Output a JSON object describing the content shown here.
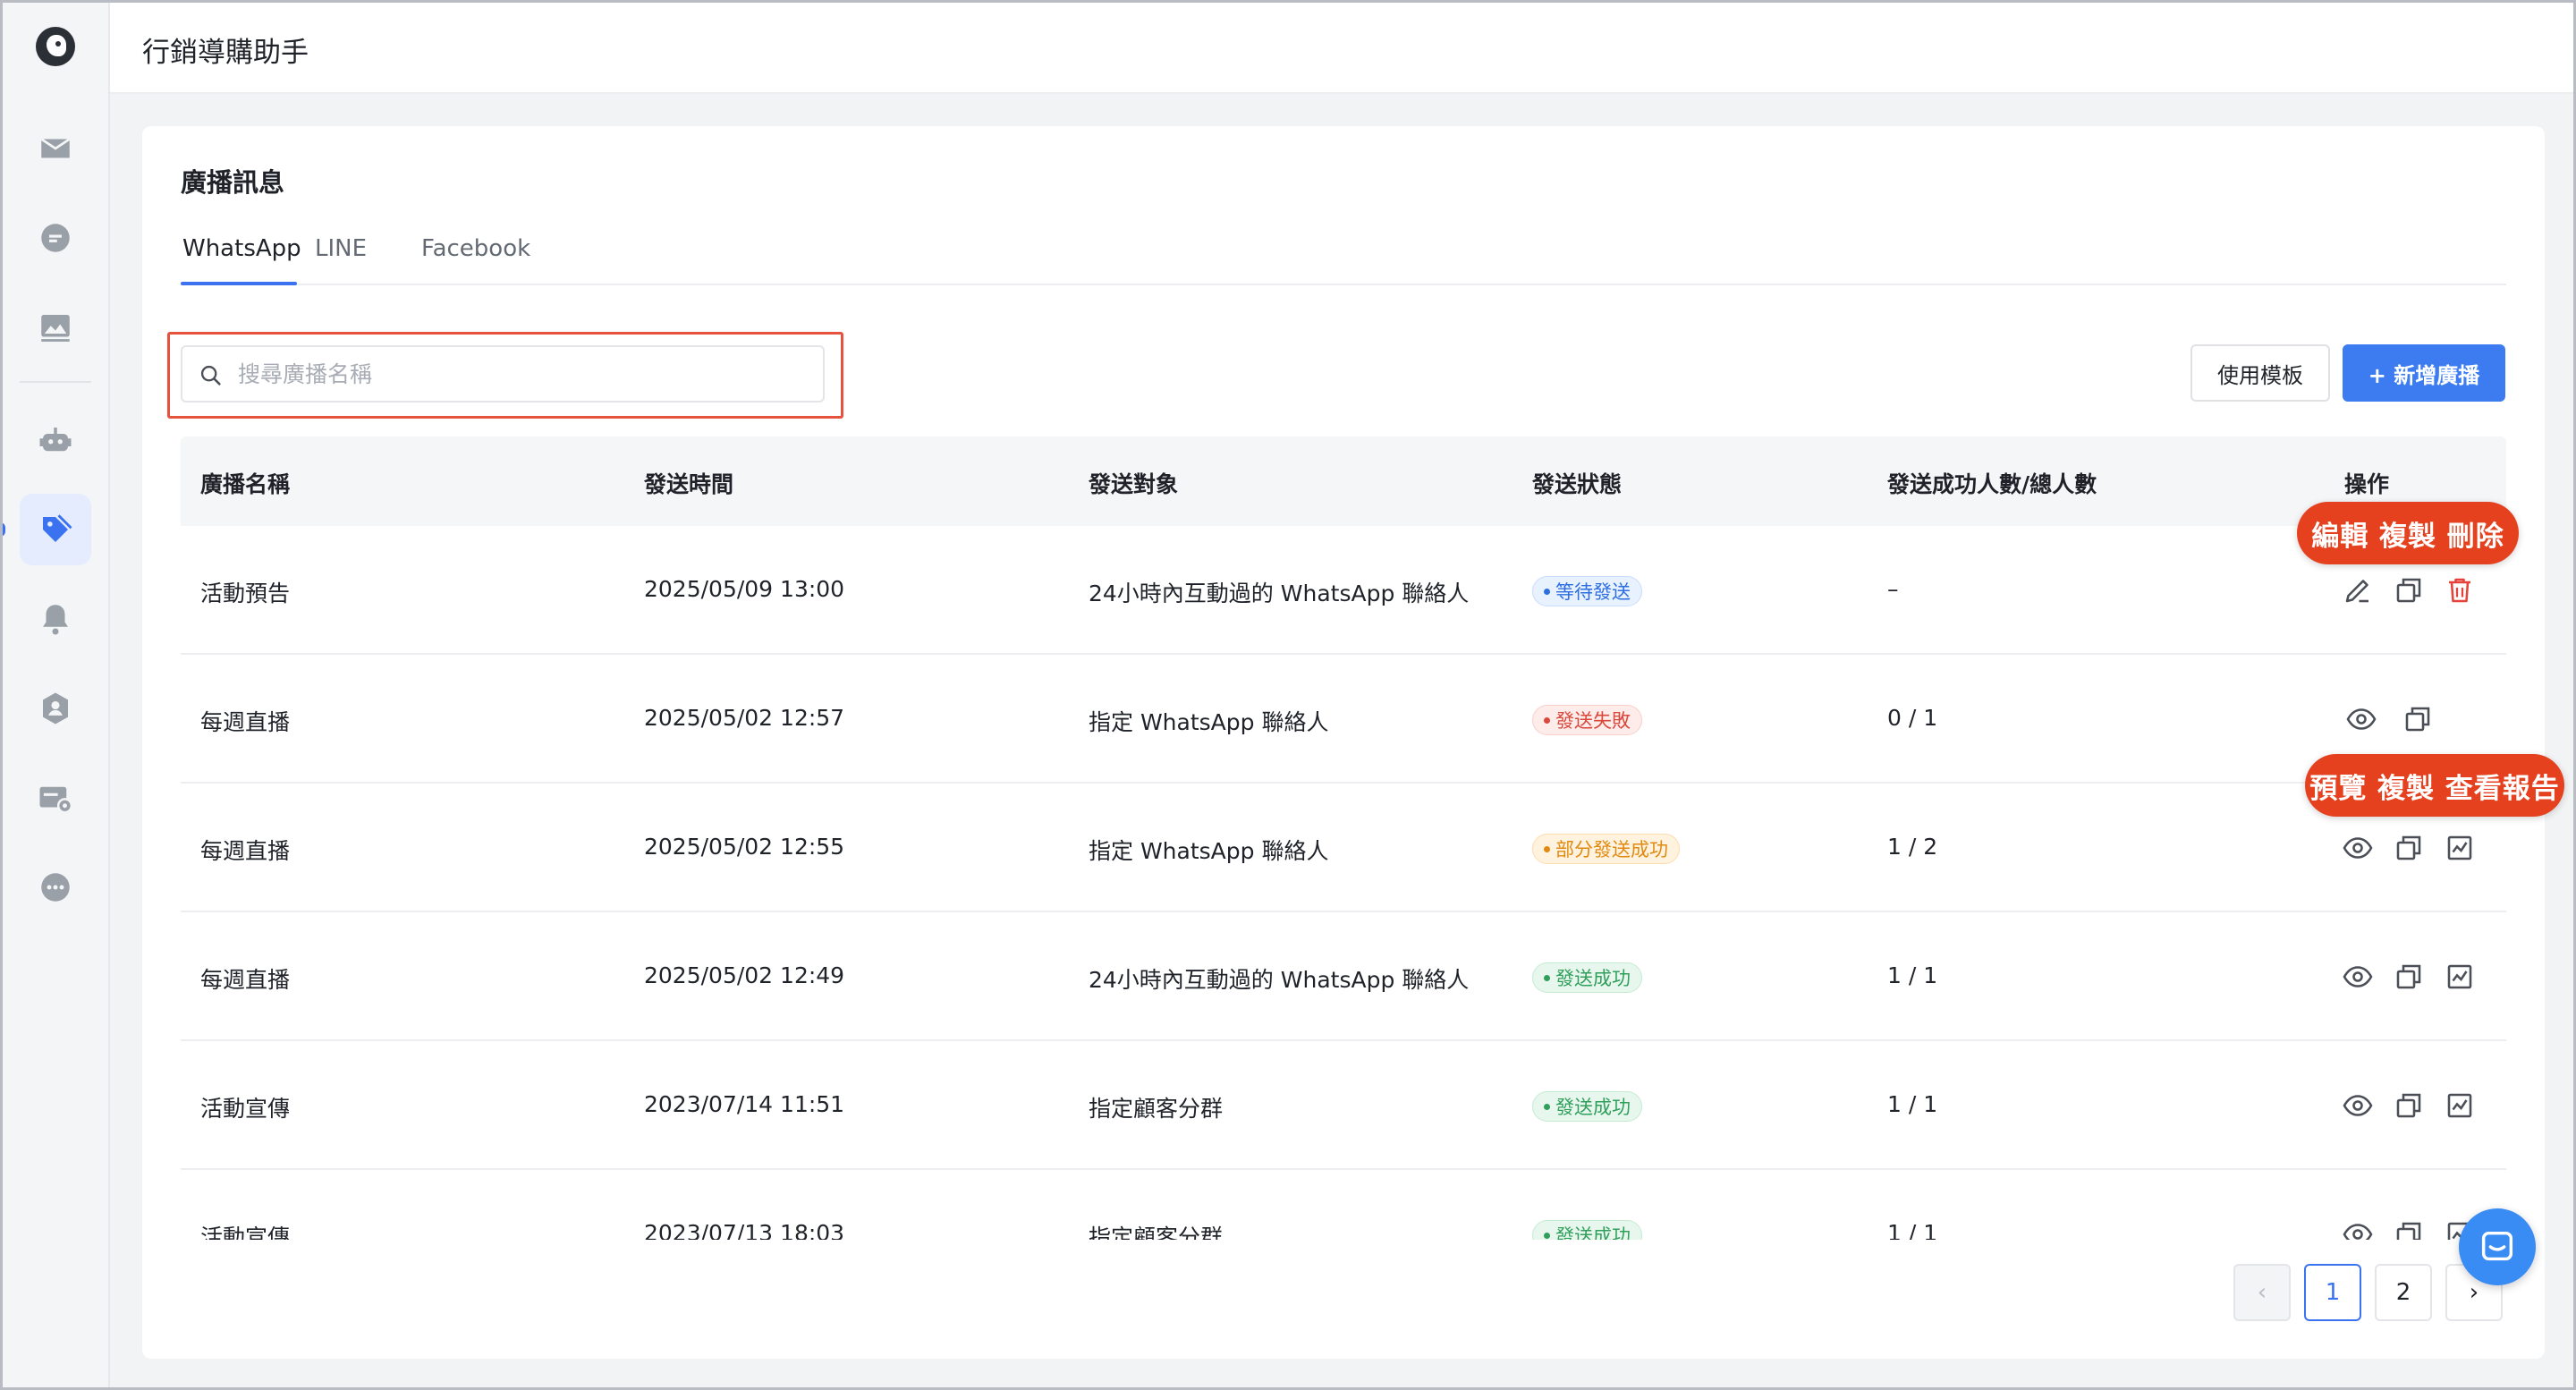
{
  "app": {
    "title": "行銷導購助手"
  },
  "sidebar": {
    "items": [
      {
        "icon": "inbox-icon"
      },
      {
        "icon": "chat-bubble-icon"
      },
      {
        "icon": "image-gallery-icon"
      },
      {
        "icon": "robot-icon"
      },
      {
        "icon": "tag-icon",
        "active": true
      },
      {
        "icon": "bell-icon"
      },
      {
        "icon": "user-badge-icon"
      },
      {
        "icon": "card-settings-icon"
      },
      {
        "icon": "more-icon"
      }
    ]
  },
  "page": {
    "title": "廣播訊息",
    "tabs": [
      {
        "label": "WhatsApp",
        "active": true
      },
      {
        "label": "LINE"
      },
      {
        "label": "Facebook"
      }
    ],
    "search": {
      "placeholder": "搜尋廣播名稱",
      "value": ""
    },
    "buttons": {
      "template": "使用模板",
      "new_broadcast": "+ 新增廣播"
    }
  },
  "table": {
    "headers": [
      "廣播名稱",
      "發送時間",
      "發送對象",
      "發送狀態",
      "發送成功人數/總人數",
      "操作"
    ],
    "rows": [
      {
        "name": "活動預告",
        "time": "2025/05/09 13:00",
        "target": "24小時內互動過的 WhatsApp 聯絡人",
        "status": "等待發送",
        "status_color": "blue",
        "ratio": "–",
        "actions": [
          "edit-icon",
          "copy-icon",
          "trash-icon"
        ]
      },
      {
        "name": "每週直播",
        "time": "2025/05/02 12:57",
        "target": "指定 WhatsApp 聯絡人",
        "status": "發送失敗",
        "status_color": "red",
        "ratio": "0 / 1",
        "actions": [
          "eye-icon",
          "copy-icon"
        ]
      },
      {
        "name": "每週直播",
        "time": "2025/05/02 12:55",
        "target": "指定 WhatsApp 聯絡人",
        "status": "部分發送成功",
        "status_color": "orange",
        "ratio": "1 / 2",
        "actions": [
          "eye-icon",
          "copy-icon",
          "report-icon"
        ]
      },
      {
        "name": "每週直播",
        "time": "2025/05/02 12:49",
        "target": "24小時內互動過的 WhatsApp 聯絡人",
        "status": "發送成功",
        "status_color": "green",
        "ratio": "1 / 1",
        "actions": [
          "eye-icon",
          "copy-icon",
          "report-icon"
        ]
      },
      {
        "name": "活動宣傳",
        "time": "2023/07/14 11:51",
        "target": "指定顧客分群",
        "status": "發送成功",
        "status_color": "green",
        "ratio": "1 / 1",
        "actions": [
          "eye-icon",
          "copy-icon",
          "report-icon"
        ]
      },
      {
        "name": "活動宣傳",
        "time": "2023/07/13 18:03",
        "target": "指定顧客分群",
        "status": "發送成功",
        "status_color": "green",
        "ratio": "1 / 1",
        "actions": [
          "eye-icon",
          "copy-icon",
          "report-icon"
        ]
      }
    ]
  },
  "callouts": {
    "top": "編輯  複製  刪除",
    "middle": "預覽 複製 查看報告"
  },
  "pagination": {
    "prev": "‹",
    "pages": [
      "1",
      "2"
    ],
    "current": "1",
    "next": "›"
  },
  "colors": {
    "primary": "#3a72f0",
    "callout": "#e5411f",
    "highlight_border": "#e5533d",
    "danger": "#e5423a"
  }
}
